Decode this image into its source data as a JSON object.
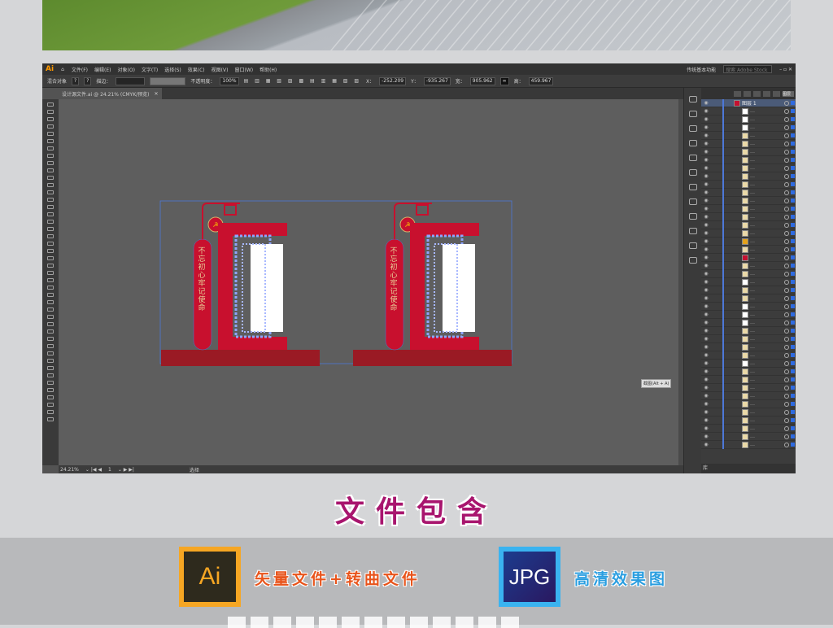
{
  "app": {
    "logo": "Ai",
    "menu": [
      "文件(F)",
      "编辑(E)",
      "对象(O)",
      "文字(T)",
      "选择(S)",
      "效果(C)",
      "视图(V)",
      "窗口(W)",
      "帮助(H)"
    ],
    "workspace": "传统基本功能",
    "search_placeholder": "搜索 Adobe Stock",
    "control": {
      "selection_label": "混合对象",
      "stroke_label": "描边：",
      "opacity_label": "不透明度：",
      "opacity_value": "100%",
      "x_label": "X：",
      "x_value": "-252.209",
      "y_label": "Y：",
      "y_value": "-935.267",
      "w_label": "宽：",
      "w_value": "905.962",
      "h_label": "高：",
      "h_value": "459.967"
    },
    "document_tab": "设计源文件.ai @ 24.21% (CMYK/预览)",
    "status": {
      "zoom": "24.21%",
      "artboard": "1",
      "tool": "选择"
    },
    "tooltip": "截图(Alt + A)",
    "layers_tab": "图层",
    "top_layer": "图层 1",
    "sublayers": [
      "white",
      "white",
      "white",
      "star",
      "star",
      "star",
      "star",
      "star",
      "star",
      "star",
      "star",
      "star",
      "star",
      "star",
      "star",
      "star",
      "org",
      "star",
      "red",
      "star",
      "star",
      "white",
      "star",
      "star",
      "white",
      "white",
      "white",
      "star",
      "star",
      "star",
      "star",
      "white",
      "star",
      "star",
      "star",
      "star",
      "star",
      "star",
      "star",
      "star",
      "star",
      "star"
    ],
    "footer_label": "库"
  },
  "design": {
    "slogan_line1": "不忘初心",
    "slogan_line2": "牢记使命",
    "colors": {
      "primary": "#c8102e",
      "base": "#9a1a24",
      "accent": "#d4b16a",
      "selection": "#4d78d8"
    }
  },
  "section": {
    "title": "文件包含",
    "ai_icon": "Ai",
    "ai_label": "矢量文件+转曲文件",
    "jpg_icon": "JPG",
    "jpg_label": "高清效果图"
  }
}
